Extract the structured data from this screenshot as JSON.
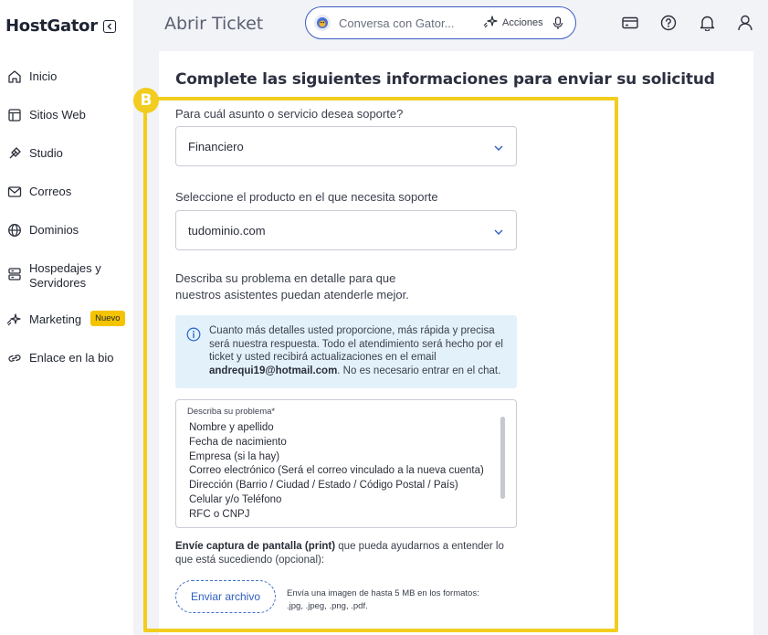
{
  "brand": {
    "logo_text": "HostGator"
  },
  "sidebar": {
    "items": [
      {
        "label": "Inicio",
        "icon": "home-icon"
      },
      {
        "label": "Sitios Web",
        "icon": "browser-icon"
      },
      {
        "label": "Studio",
        "icon": "studio-icon"
      },
      {
        "label": "Correos",
        "icon": "mail-icon"
      },
      {
        "label": "Dominios",
        "icon": "globe-icon"
      },
      {
        "label": "Hospedajes y Servidores",
        "label_line1": "Hospedajes y",
        "label_line2": "Servidores",
        "icon": "server-icon"
      },
      {
        "label": "Marketing",
        "icon": "sparkle-icon",
        "badge": "Nuevo"
      },
      {
        "label": "Enlace en la bio",
        "icon": "link-icon"
      }
    ]
  },
  "header": {
    "title": "Abrir Ticket",
    "search_placeholder": "Conversa con Gator...",
    "actions_label": "Acciones"
  },
  "form": {
    "heading": "Complete las siguientes informaciones para enviar su solicitud",
    "step_badge": "B",
    "subject_label": "Para cuál asunto o servicio desea soporte?",
    "subject_value": "Financiero",
    "product_label": "Seleccione el producto en el que necesita soporte",
    "product_value": "tudominio.com",
    "description_line1": "Describa su problema en detalle para que",
    "description_line2": "nuestros asistentes puedan atenderle mejor.",
    "info_text_before": "Cuanto más detalles usted proporcione, más rápida y precisa será nuestra respuesta. Todo el atendimiento será hecho por el ticket y usted recibirá actualizaciones en el email ",
    "info_email": "andrequi19@hotmail.com",
    "info_text_after": ". No es necesario entrar en el chat.",
    "textarea_label": "Describa su problema*",
    "textarea_lines": [
      "Nombre y apellido",
      "Fecha de nacimiento",
      "Empresa (si la hay)",
      "Correo electrónico (Será el correo vinculado a la nueva cuenta)",
      "Dirección (Barrio / Ciudad / Estado / Código Postal / País)",
      "Celular y/o Teléfono",
      "RFC o CNPJ"
    ],
    "upload_bold": "Envíe captura de pantalla (print)",
    "upload_rest": " que pueda ayudarnos a entender lo que está sucediendo (opcional):",
    "upload_button": "Enviar archivo",
    "upload_hint_line1": "Envía una imagen de hasta 5 MB en los formatos:",
    "upload_hint_line2": ".jpg, .jpeg, .png, .pdf."
  },
  "colors": {
    "accent_yellow": "#f2cd1f",
    "link_blue": "#2f5fbf",
    "info_bg": "#e3f1fb"
  }
}
